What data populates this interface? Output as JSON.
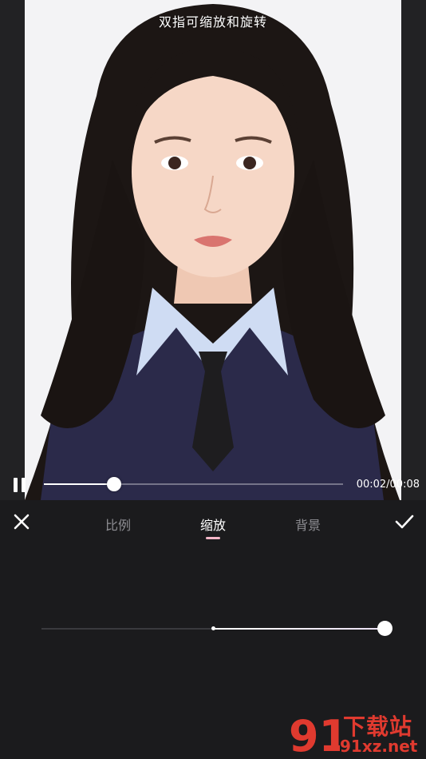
{
  "preview": {
    "hint": "双指可缩放和旋转",
    "time": "00:02/00:08",
    "progress": 0.234
  },
  "tabs": [
    {
      "label": "比例",
      "active": false
    },
    {
      "label": "缩放",
      "active": true
    },
    {
      "label": "背景",
      "active": false
    }
  ],
  "zoom": {
    "center": 0.5,
    "value": 1.0
  },
  "watermark": {
    "logo": "91",
    "title": "下载站",
    "url": "91xz.net"
  },
  "colors": {
    "accent": "#f4b6c8",
    "background": "#1b1b1d",
    "watermark": "#e03a2f"
  },
  "icons": {
    "pause": "pause-icon",
    "close": "close-icon",
    "confirm": "check-icon"
  }
}
